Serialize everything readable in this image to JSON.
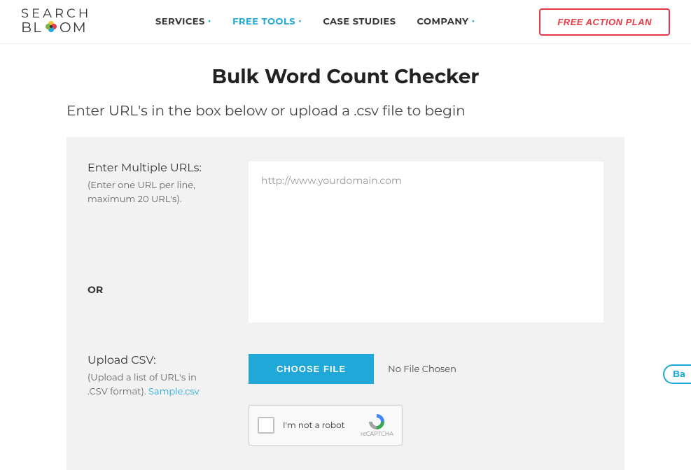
{
  "header": {
    "logo_top": "SEARCH",
    "logo_bottom_left": "BL",
    "logo_bottom_right": "OM",
    "nav": [
      {
        "label": "SERVICES",
        "active": false,
        "dropdown": true
      },
      {
        "label": "FREE TOOLS",
        "active": true,
        "dropdown": true
      },
      {
        "label": "CASE STUDIES",
        "active": false,
        "dropdown": false
      },
      {
        "label": "COMPANY",
        "active": false,
        "dropdown": true
      }
    ],
    "cta": "FREE ACTION PLAN"
  },
  "page": {
    "title": "Bulk Word Count Checker",
    "subtitle": "Enter URL's in the box below or upload a .csv file to begin"
  },
  "form": {
    "urls_label": "Enter Multiple URLs:",
    "urls_hint": "(Enter one URL per line, maximum 20 URL's).",
    "urls_placeholder": "http://www.yourdomain.com",
    "or_label": "OR",
    "csv_label": "Upload CSV:",
    "csv_hint_prefix": "(Upload a list of URL's in .CSV format). ",
    "csv_sample_link": "Sample.csv",
    "choose_file_label": "CHOOSE FILE",
    "file_status": "No File Chosen",
    "recaptcha_label": "I'm not a robot",
    "recaptcha_brand": "reCAPTCHA"
  },
  "back_tab": "Ba"
}
